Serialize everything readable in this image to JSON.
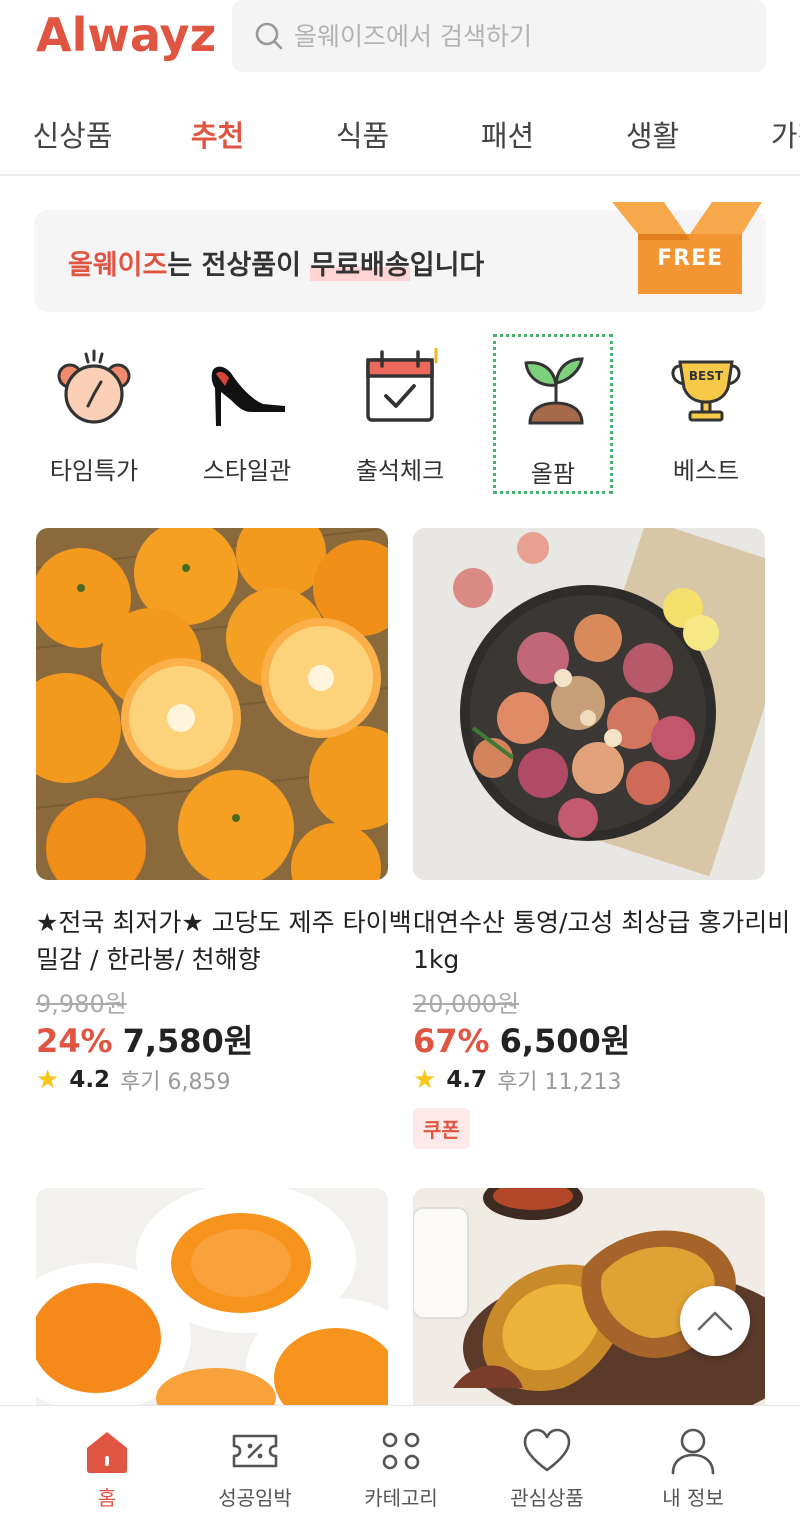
{
  "header": {
    "logo": "Alwayz",
    "search_placeholder": "올웨이즈에서 검색하기"
  },
  "tabs": [
    {
      "label": "신상품",
      "active": false
    },
    {
      "label": "추천",
      "active": true
    },
    {
      "label": "식품",
      "active": false
    },
    {
      "label": "패션",
      "active": false
    },
    {
      "label": "생활",
      "active": false
    },
    {
      "label": "가전",
      "active": false
    }
  ],
  "banner": {
    "brand": "올웨이즈",
    "text_part1": "는 전상품이 ",
    "highlight": "무료배송",
    "text_part2": "입니다",
    "badge": "FREE"
  },
  "categories": [
    {
      "label": "타임특가",
      "icon": "alarm-clock-icon"
    },
    {
      "label": "스타일관",
      "icon": "high-heel-icon"
    },
    {
      "label": "출석체크",
      "icon": "calendar-check-icon"
    },
    {
      "label": "올팜",
      "icon": "sprout-icon",
      "selected": true
    },
    {
      "label": "베스트",
      "icon": "best-trophy-icon"
    }
  ],
  "products": [
    {
      "name": "★전국 최저가★ 고당도 제주 타이백밀감 / 한라봉/ 천해향",
      "original_price": "9,980원",
      "discount": "24%",
      "price": "7,580원",
      "rating": "4.2",
      "reviews": "후기 6,859",
      "coupon": ""
    },
    {
      "name": "대연수산 통영/고성 최상급 홍가리비 1kg",
      "original_price": "20,000원",
      "discount": "67%",
      "price": "6,500원",
      "rating": "4.7",
      "reviews": "후기 11,213",
      "coupon": "쿠폰"
    }
  ],
  "bottom_nav": [
    {
      "label": "홈",
      "icon": "home-icon",
      "active": true
    },
    {
      "label": "성공임박",
      "icon": "ticket-icon",
      "active": false
    },
    {
      "label": "카테고리",
      "icon": "grid-dots-icon",
      "active": false
    },
    {
      "label": "관심상품",
      "icon": "heart-icon",
      "active": false
    },
    {
      "label": "내 정보",
      "icon": "user-icon",
      "active": false
    }
  ],
  "colors": {
    "accent": "#e05542",
    "star": "#f5c518",
    "selected_border": "#45b56e"
  }
}
